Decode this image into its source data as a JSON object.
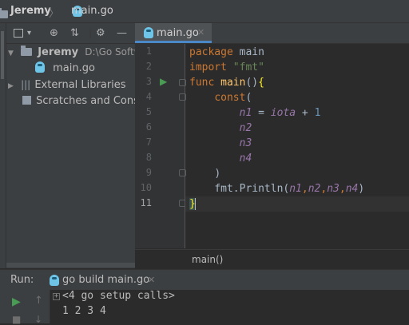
{
  "breadcrumb": {
    "project": "Jeremy",
    "file": "main.go"
  },
  "project_panel": {
    "root": {
      "name": "Jeremy",
      "path": "D:\\Go Softw"
    },
    "file": "main.go",
    "external": "External Libraries",
    "scratches": "Scratches and Conso"
  },
  "editor": {
    "tab_label": "main.go",
    "line_numbers": [
      "1",
      "2",
      "3",
      "4",
      "5",
      "6",
      "7",
      "8",
      "9",
      "10",
      "11"
    ],
    "code": {
      "l1_kw": "package",
      "l1_rest": " main",
      "l2_kw": "import",
      "l2_str": " \"fmt\"",
      "l3_kw": "func",
      "l3_fn": "main",
      "l3_paren": "()",
      "l3_brace": "{",
      "l4_kw": "const",
      "l4_paren": "(",
      "l5_var": "n1",
      "l5_eq": " = ",
      "l5_iota": "iota",
      "l5_plus": " + ",
      "l5_num": "1",
      "l6_var": "n2",
      "l7_var": "n3",
      "l8_var": "n4",
      "l9_paren": ")",
      "l10_call": "fmt.Println(",
      "l10_a": "n1",
      "l10_b": "n2",
      "l10_c": "n3",
      "l10_d": "n4",
      "l10_close": ")",
      "l11_brace": "}"
    },
    "footer_breadcrumb": "main()"
  },
  "run_panel": {
    "label": "Run:",
    "tab_label": "go build main.go",
    "console": {
      "collapsed_calls": "<4 go setup calls>",
      "output": "1 2 3 4"
    }
  },
  "colors": {
    "keyword": "#cc7832",
    "string": "#6a8759",
    "function": "#ffc66d",
    "variable": "#9876aa",
    "number": "#6897bb",
    "accent": "#4a88c7"
  }
}
